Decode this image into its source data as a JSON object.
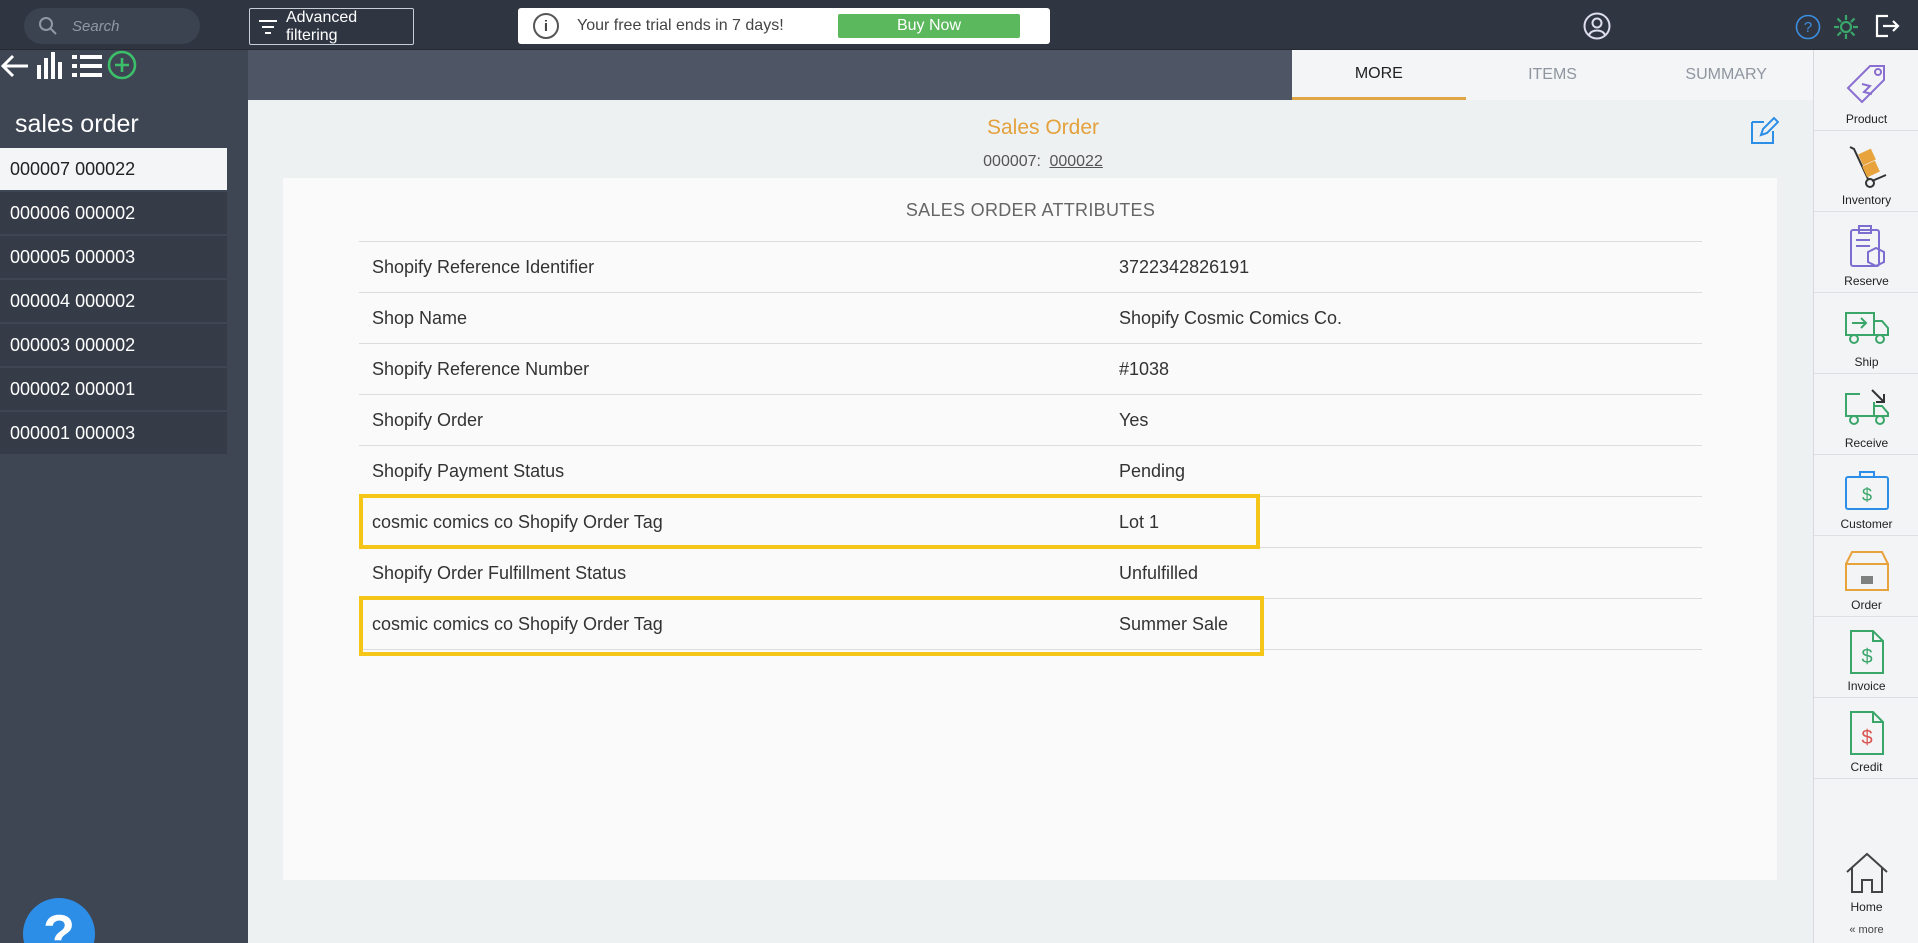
{
  "topbar": {
    "search_placeholder": "Search",
    "advanced_filter_label": "Advanced filtering",
    "trial_message": "Your free trial ends in 7 days!",
    "buy_label": "Buy Now"
  },
  "sidebar": {
    "title": "sales order",
    "orders": [
      {
        "label": "000007 000022",
        "active": true
      },
      {
        "label": "000006 000002"
      },
      {
        "label": "000005 000003"
      },
      {
        "label": "000004 000002"
      },
      {
        "label": "000003 000002"
      },
      {
        "label": "000002 000001"
      },
      {
        "label": "000001 000003"
      }
    ],
    "help_label": "?"
  },
  "tabs": [
    {
      "label": "MORE",
      "active": true
    },
    {
      "label": "ITEMS"
    },
    {
      "label": "SUMMARY"
    }
  ],
  "main": {
    "title": "Sales Order",
    "sub_prefix": "000007:",
    "sub_link": "000022",
    "card_title": "SALES ORDER ATTRIBUTES",
    "attributes": [
      {
        "key": "Shopify Reference Identifier",
        "value": "3722342826191"
      },
      {
        "key": "Shop Name",
        "value": "Shopify Cosmic Comics Co."
      },
      {
        "key": "Shopify Reference Number",
        "value": "#1038"
      },
      {
        "key": "Shopify Order",
        "value": "Yes"
      },
      {
        "key": "Shopify Payment Status",
        "value": "Pending"
      },
      {
        "key": "cosmic comics co Shopify Order Tag",
        "value": "Lot 1"
      },
      {
        "key": "Shopify Order Fulfillment Status",
        "value": "Unfulfilled"
      },
      {
        "key": "cosmic comics co Shopify Order Tag",
        "value": "Summer Sale"
      }
    ]
  },
  "rightbar": {
    "items": [
      {
        "label": "Product",
        "icon": "product-tag-icon",
        "color": "#8a6fd1"
      },
      {
        "label": "Inventory",
        "icon": "hand-truck-icon",
        "color": "#e8a33d"
      },
      {
        "label": "Reserve",
        "icon": "clipboard-box-icon",
        "color": "#7a6fd1"
      },
      {
        "label": "Ship",
        "icon": "truck-out-icon",
        "color": "#3aa66a"
      },
      {
        "label": "Receive",
        "icon": "truck-in-icon",
        "color": "#3aa66a"
      },
      {
        "label": "Customer",
        "icon": "briefcase-dollar-icon",
        "color": "#2d8ee8"
      },
      {
        "label": "Order",
        "icon": "order-box-icon",
        "color": "#e8a33d"
      },
      {
        "label": "Invoice",
        "icon": "invoice-dollar-icon",
        "color": "#3aa66a"
      },
      {
        "label": "Credit",
        "icon": "credit-dollar-icon",
        "color": "#d9534f"
      },
      {
        "label": "Home",
        "icon": "home-icon",
        "color": "#444444"
      }
    ],
    "more_label": "« more"
  }
}
